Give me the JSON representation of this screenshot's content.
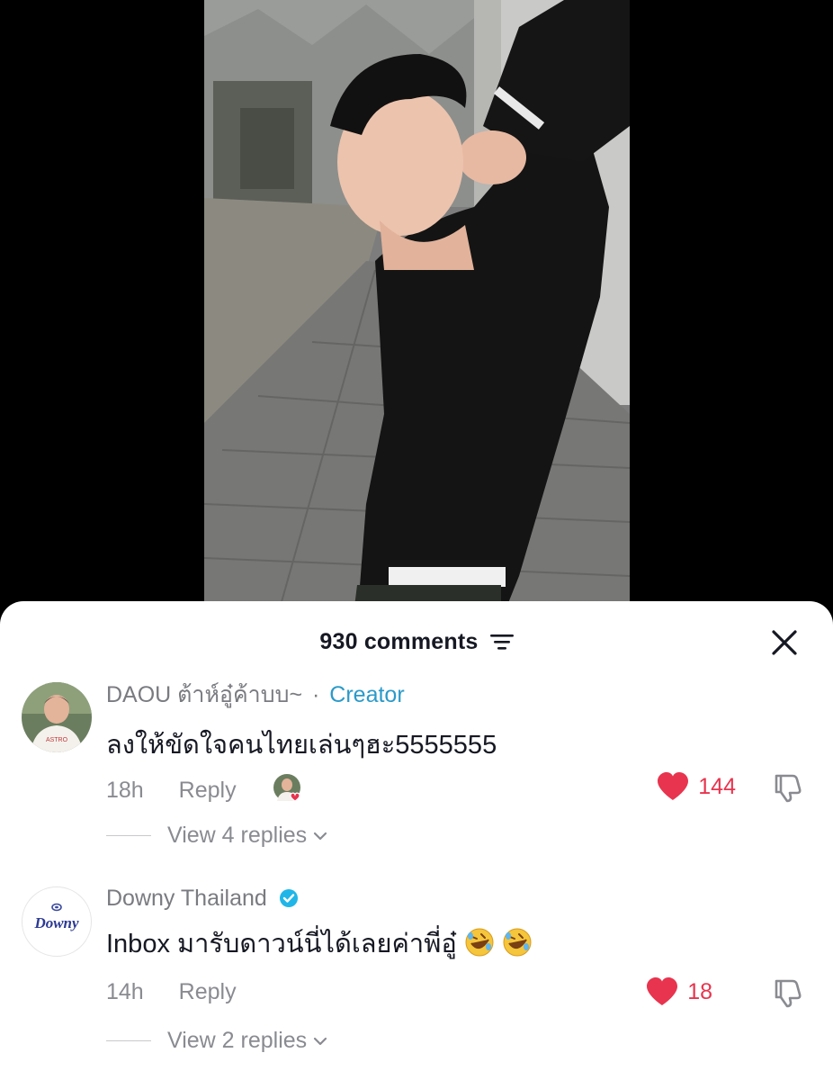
{
  "comments_panel": {
    "count_label": "930 comments",
    "filter_icon": "sort-filter-icon",
    "close_icon": "close-icon"
  },
  "comments": [
    {
      "author": "DAOU ต้าห์อู๋ค้าบบ~",
      "creator_label": "Creator",
      "separator": "·",
      "text": "ลงให้ขัดใจคนไทยเล่นๆฮะ5555555",
      "time": "18h",
      "reply_label": "Reply",
      "likes": "144",
      "view_replies": "View 4 replies",
      "liked_by_creator": true
    },
    {
      "author": "Downy Thailand",
      "verified": true,
      "avatar_text": "Downy",
      "text": "Inbox มารับดาวน์นี่ได้เลยค่าพี่อู๋",
      "emoji": "rolling-on-floor-laughing-emoji",
      "time": "14h",
      "reply_label": "Reply",
      "likes": "18",
      "view_replies": "View 2 replies"
    }
  ],
  "colors": {
    "like_red": "#e8344e",
    "creator_blue": "#2b9ac9",
    "verified_blue": "#20b6e8",
    "muted_gray": "#8a8b91",
    "text_dark": "#161823"
  }
}
